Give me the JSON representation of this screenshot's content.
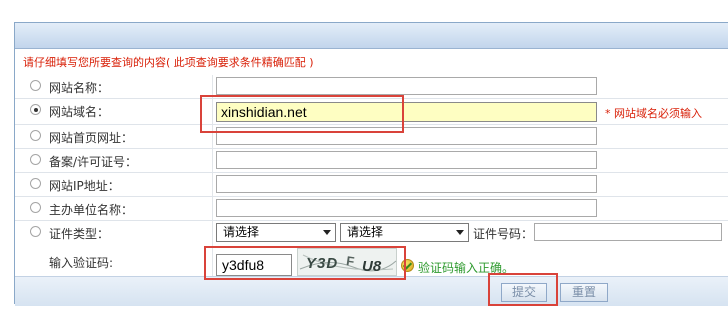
{
  "form": {
    "note": "请仔细填写您所要查询的内容( 此项查询要求条件精确匹配 )",
    "rows": [
      {
        "label": "网站名称：",
        "value": "",
        "checked": false
      },
      {
        "label": "网站域名：",
        "value": "xinshidian.net",
        "checked": true,
        "required_note": "* 网站域名必须输入"
      },
      {
        "label": "网站首页网址：",
        "value": "",
        "checked": false
      },
      {
        "label": "备案/许可证号：",
        "value": "",
        "checked": false
      },
      {
        "label": "网站IP地址：",
        "value": "",
        "checked": false
      },
      {
        "label": "主办单位名称：",
        "value": "",
        "checked": false
      },
      {
        "label": "证件类型：",
        "checked": false
      }
    ],
    "cert": {
      "select1": "请选择",
      "select2": "请选择",
      "number_label": "证件号码："
    },
    "captcha": {
      "label": "输入验证码:",
      "value": "y3dfu8",
      "image_text": "Y3DFU8",
      "ok_text": "验证码输入正确。"
    },
    "buttons": {
      "submit": "提交",
      "reset": "重置"
    }
  },
  "colors": {
    "note_red": "#d81e06",
    "highlight_red": "#d9433a",
    "ok_green": "#2e9a2e",
    "active_field_bg": "#fefec2"
  }
}
